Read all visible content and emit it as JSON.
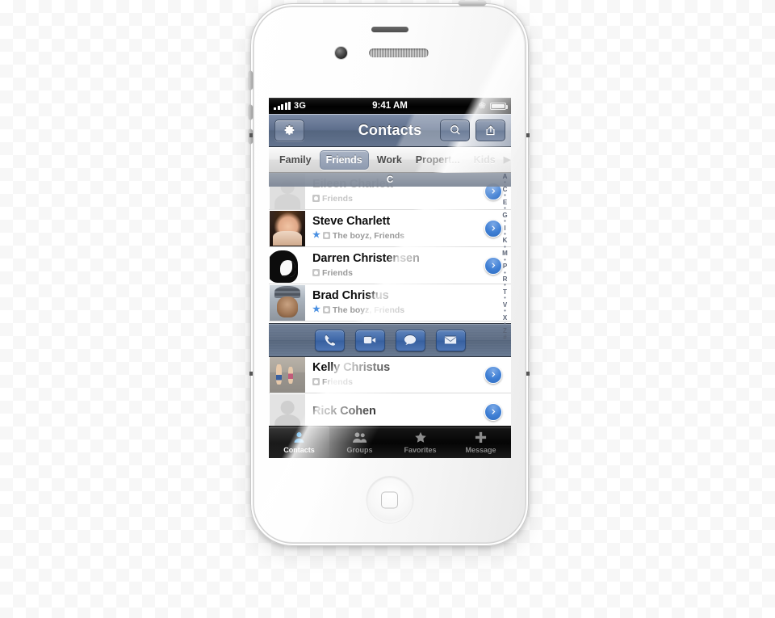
{
  "device": {
    "name": "iPhone 4S White",
    "home_button": "home-button",
    "camera": "front-camera",
    "earpiece": "earpiece-speaker"
  },
  "statusbar": {
    "signal_icon": "signal-bars-icon",
    "carrier": "3G",
    "time": "9:41 AM",
    "bluetooth_icon": "bluetooth-icon",
    "battery_icon": "battery-icon"
  },
  "navbar": {
    "settings_icon": "gear-icon",
    "title": "Contacts",
    "search_icon": "search-icon",
    "share_icon": "share-icon"
  },
  "grouptabs": {
    "items": [
      {
        "label": "Family",
        "selected": false,
        "dim": false
      },
      {
        "label": "Friends",
        "selected": true,
        "dim": false
      },
      {
        "label": "Work",
        "selected": false,
        "dim": false
      },
      {
        "label": "Propert...",
        "selected": false,
        "dim": false
      },
      {
        "label": "Kids",
        "selected": false,
        "dim": true
      }
    ],
    "more_arrow": "▶"
  },
  "section_header": {
    "letter": "C"
  },
  "contacts": [
    {
      "name": "Eileen Charlett",
      "groups": "Friends",
      "favorite": false,
      "avatar": "placeholder-silhouette",
      "disclosure": "chevron-right-icon"
    },
    {
      "name": "Steve Charlett",
      "groups": "The boyz, Friends",
      "favorite": true,
      "avatar": "photo-portrait",
      "disclosure": "chevron-right-icon"
    },
    {
      "name": "Darren Christensen",
      "groups": "Friends",
      "favorite": false,
      "avatar": "photo-portrait-bw",
      "disclosure": "chevron-right-icon"
    },
    {
      "name": "Brad Christus",
      "groups": "The boyz, Friends",
      "favorite": true,
      "avatar": "photo-portrait-beanie",
      "disclosure": "chevron-right-icon"
    },
    {
      "name": "Kelly Christus",
      "groups": "Friends",
      "favorite": false,
      "avatar": "photo-children",
      "disclosure": "chevron-right-icon"
    },
    {
      "name": "Rick Cohen",
      "groups": "",
      "favorite": false,
      "avatar": "placeholder-silhouette",
      "disclosure": "chevron-right-icon"
    }
  ],
  "actionbar": {
    "buttons": [
      {
        "name": "call-button",
        "icon": "phone-icon"
      },
      {
        "name": "facetime-button",
        "icon": "video-camera-icon"
      },
      {
        "name": "message-button",
        "icon": "speech-bubble-icon"
      },
      {
        "name": "email-button",
        "icon": "envelope-icon"
      }
    ]
  },
  "index_strip": {
    "entries": [
      "A",
      "•",
      "C",
      "•",
      "E",
      "•",
      "G",
      "•",
      "I",
      "•",
      "K",
      "•",
      "M",
      "•",
      "P",
      "•",
      "R",
      "•",
      "T",
      "•",
      "V",
      "•",
      "X",
      "•",
      "Z",
      "#"
    ]
  },
  "tabbar": {
    "items": [
      {
        "label": "Contacts",
        "icon": "person-icon",
        "active": true
      },
      {
        "label": "Groups",
        "icon": "people-icon",
        "active": false
      },
      {
        "label": "Favorites",
        "icon": "star-icon",
        "active": false
      },
      {
        "label": "Message",
        "icon": "plus-icon",
        "active": false
      }
    ]
  },
  "colors": {
    "accent_blue": "#3f7fd4",
    "navbar_blue": "#5d6e8c",
    "tab_active": "#5ab4f0",
    "star_blue": "#4a90e2"
  }
}
